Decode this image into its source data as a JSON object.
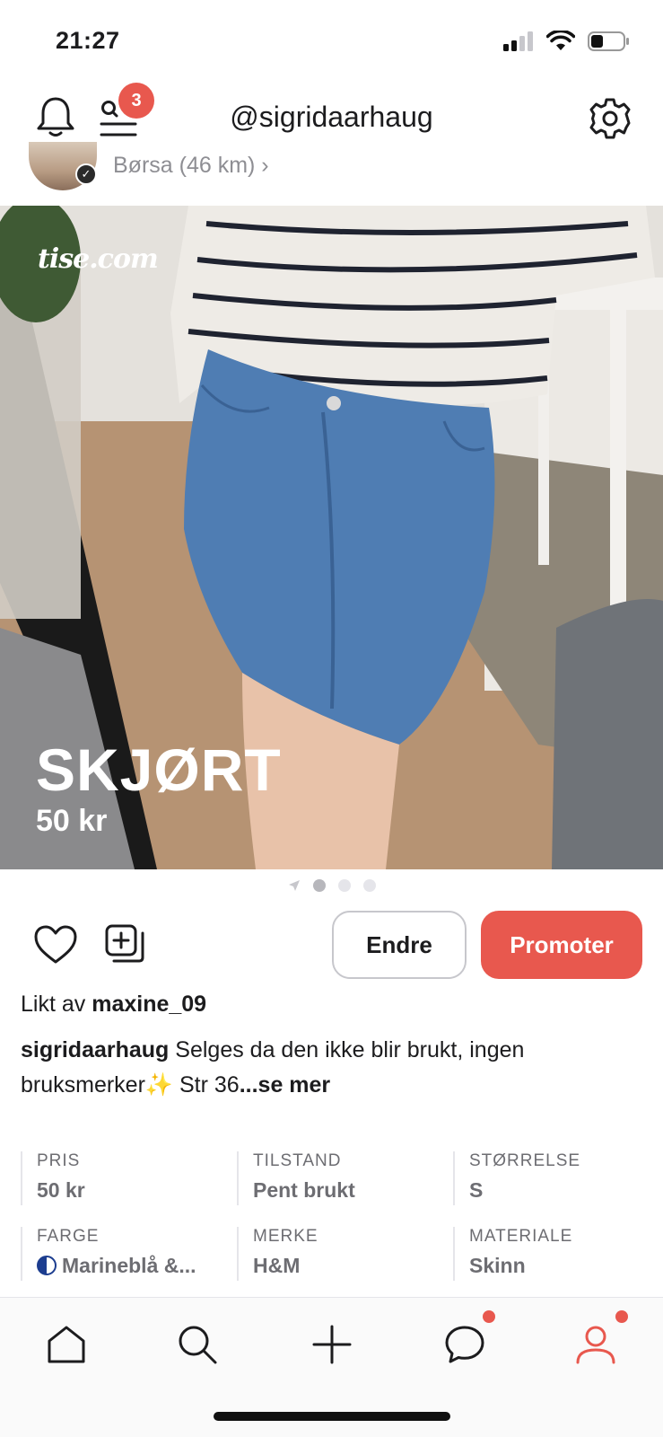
{
  "status_bar": {
    "time": "21:27"
  },
  "header": {
    "username": "@sigridaarhaug",
    "notification_badge": "3",
    "icons": [
      "bell-icon",
      "search-list-icon",
      "gear-icon"
    ]
  },
  "seller": {
    "location": "Børsa (46 km) ›"
  },
  "listing": {
    "brand_watermark": "tise.com",
    "title": "SKJØRT",
    "price": "50 kr",
    "image_count": 3,
    "active_image": 1
  },
  "actions": {
    "edit_label": "Endre",
    "promote_label": "Promoter",
    "accent_color": "#e8584e"
  },
  "likes": {
    "prefix": "Likt av",
    "user": "maxine_09"
  },
  "description": {
    "author": "sigridaarhaug",
    "text": "Selges da den ikke blir brukt, ingen bruksmerker✨ Str 36",
    "more": "...se mer"
  },
  "details": [
    {
      "label": "PRIS",
      "value": "50 kr"
    },
    {
      "label": "TILSTAND",
      "value": "Pent brukt"
    },
    {
      "label": "STØRRELSE",
      "value": "S"
    },
    {
      "label": "FARGE",
      "value": "Marineblå &..."
    },
    {
      "label": "MERKE",
      "value": "H&M"
    },
    {
      "label": "MATERIALE",
      "value": "Skinn"
    }
  ],
  "tabbar": {
    "tabs": [
      "home-icon",
      "search-icon",
      "add-icon",
      "chat-icon",
      "profile-icon"
    ],
    "active_tab": "profile-icon"
  }
}
